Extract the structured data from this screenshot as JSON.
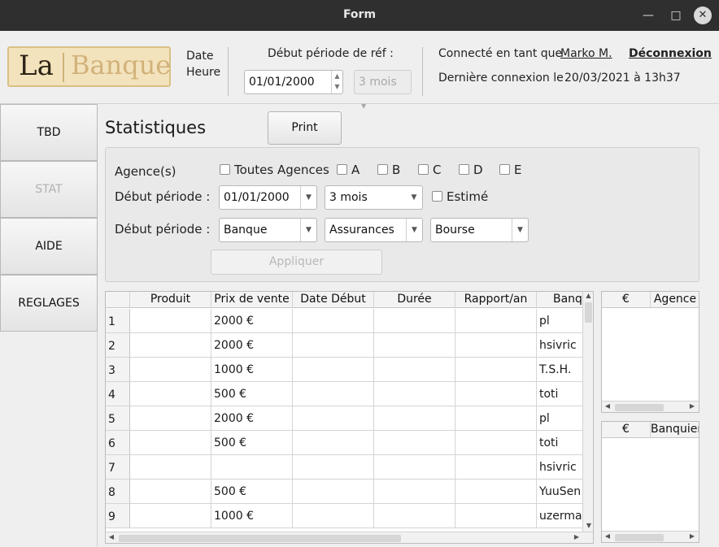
{
  "window": {
    "title": "Form"
  },
  "header": {
    "logo": {
      "part1": "La",
      "part2": "Banque"
    },
    "date_label": "Date",
    "time_label": "Heure",
    "period_label": "Début période de réf :",
    "period_date": "01/01/2000",
    "period_duration": "3 mois",
    "connected_as_label": "Connecté en tant que",
    "user_name": "Marko M.",
    "logout_label": "Déconnexion",
    "last_login_label": "Dernière connexion le",
    "last_login_value": "20/03/2021 à 13h37"
  },
  "sidebar": {
    "items": [
      {
        "label": "TBD",
        "enabled": true
      },
      {
        "label": "STAT",
        "enabled": false
      },
      {
        "label": "AIDE",
        "enabled": true
      },
      {
        "label": "REGLAGES",
        "enabled": true
      }
    ]
  },
  "main": {
    "title": "Statistiques",
    "print_label": "Print"
  },
  "filters": {
    "agencies_label": "Agence(s)",
    "all_agencies_label": "Toutes Agences",
    "agencies": [
      "A",
      "B",
      "C",
      "D",
      "E"
    ],
    "start_label_1": "Début période :",
    "start_date": "01/01/2000",
    "duration": "3 mois",
    "estimated_label": "Estimé",
    "start_label_2": "Début période :",
    "category_1": "Banque",
    "category_2": "Assurances",
    "category_3": "Bourse",
    "apply_label": "Appliquer"
  },
  "table": {
    "columns": [
      "Produit",
      "Prix de vente",
      "Date Début",
      "Durée",
      "Rapport/an",
      "Banquier"
    ],
    "rows": [
      {
        "n": "1",
        "produit": "",
        "prix": "2000 €",
        "debut": "",
        "duree": "",
        "rapport": "",
        "banquier": "pl"
      },
      {
        "n": "2",
        "produit": "",
        "prix": "2000 €",
        "debut": "",
        "duree": "",
        "rapport": "",
        "banquier": "hsivric"
      },
      {
        "n": "3",
        "produit": "",
        "prix": "1000 €",
        "debut": "",
        "duree": "",
        "rapport": "",
        "banquier": "T.S.H."
      },
      {
        "n": "4",
        "produit": "",
        "prix": "500 €",
        "debut": "",
        "duree": "",
        "rapport": "",
        "banquier": "toti"
      },
      {
        "n": "5",
        "produit": "",
        "prix": "2000 €",
        "debut": "",
        "duree": "",
        "rapport": "",
        "banquier": "pl"
      },
      {
        "n": "6",
        "produit": "",
        "prix": "500 €",
        "debut": "",
        "duree": "",
        "rapport": "",
        "banquier": "toti"
      },
      {
        "n": "7",
        "produit": "",
        "prix": "",
        "debut": "",
        "duree": "",
        "rapport": "",
        "banquier": "hsivric"
      },
      {
        "n": "8",
        "produit": "",
        "prix": "500 €",
        "debut": "",
        "duree": "",
        "rapport": "",
        "banquier": "YuuSen"
      },
      {
        "n": "9",
        "produit": "",
        "prix": "1000 €",
        "debut": "",
        "duree": "",
        "rapport": "",
        "banquier": "uzerman"
      }
    ]
  },
  "side_table_1": {
    "columns": [
      "€",
      "Agence"
    ]
  },
  "side_table_2": {
    "columns": [
      "€",
      "Banquier"
    ]
  }
}
